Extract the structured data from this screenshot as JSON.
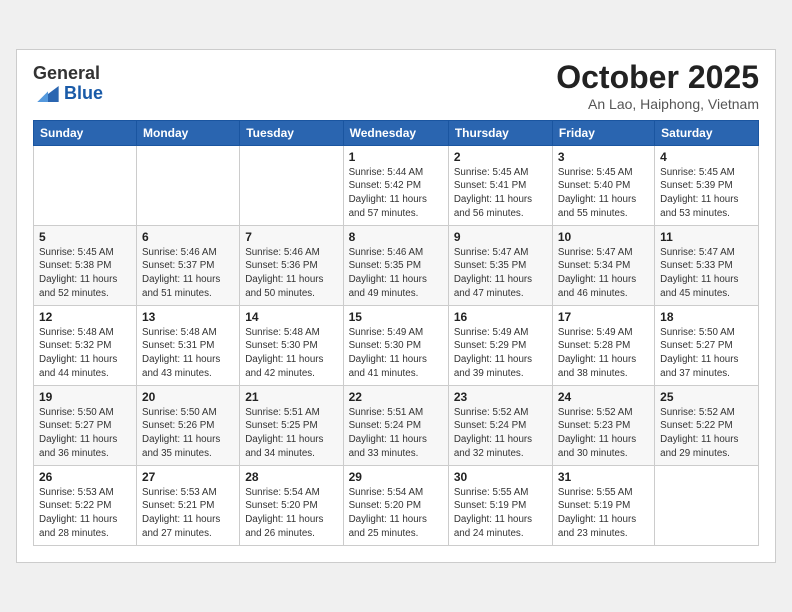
{
  "header": {
    "logo_line1": "General",
    "logo_line2": "Blue",
    "month_title": "October 2025",
    "location": "An Lao, Haiphong, Vietnam"
  },
  "weekdays": [
    "Sunday",
    "Monday",
    "Tuesday",
    "Wednesday",
    "Thursday",
    "Friday",
    "Saturday"
  ],
  "weeks": [
    [
      {
        "day": "",
        "sunrise": "",
        "sunset": "",
        "daylight": ""
      },
      {
        "day": "",
        "sunrise": "",
        "sunset": "",
        "daylight": ""
      },
      {
        "day": "",
        "sunrise": "",
        "sunset": "",
        "daylight": ""
      },
      {
        "day": "1",
        "sunrise": "Sunrise: 5:44 AM",
        "sunset": "Sunset: 5:42 PM",
        "daylight": "Daylight: 11 hours and 57 minutes."
      },
      {
        "day": "2",
        "sunrise": "Sunrise: 5:45 AM",
        "sunset": "Sunset: 5:41 PM",
        "daylight": "Daylight: 11 hours and 56 minutes."
      },
      {
        "day": "3",
        "sunrise": "Sunrise: 5:45 AM",
        "sunset": "Sunset: 5:40 PM",
        "daylight": "Daylight: 11 hours and 55 minutes."
      },
      {
        "day": "4",
        "sunrise": "Sunrise: 5:45 AM",
        "sunset": "Sunset: 5:39 PM",
        "daylight": "Daylight: 11 hours and 53 minutes."
      }
    ],
    [
      {
        "day": "5",
        "sunrise": "Sunrise: 5:45 AM",
        "sunset": "Sunset: 5:38 PM",
        "daylight": "Daylight: 11 hours and 52 minutes."
      },
      {
        "day": "6",
        "sunrise": "Sunrise: 5:46 AM",
        "sunset": "Sunset: 5:37 PM",
        "daylight": "Daylight: 11 hours and 51 minutes."
      },
      {
        "day": "7",
        "sunrise": "Sunrise: 5:46 AM",
        "sunset": "Sunset: 5:36 PM",
        "daylight": "Daylight: 11 hours and 50 minutes."
      },
      {
        "day": "8",
        "sunrise": "Sunrise: 5:46 AM",
        "sunset": "Sunset: 5:35 PM",
        "daylight": "Daylight: 11 hours and 49 minutes."
      },
      {
        "day": "9",
        "sunrise": "Sunrise: 5:47 AM",
        "sunset": "Sunset: 5:35 PM",
        "daylight": "Daylight: 11 hours and 47 minutes."
      },
      {
        "day": "10",
        "sunrise": "Sunrise: 5:47 AM",
        "sunset": "Sunset: 5:34 PM",
        "daylight": "Daylight: 11 hours and 46 minutes."
      },
      {
        "day": "11",
        "sunrise": "Sunrise: 5:47 AM",
        "sunset": "Sunset: 5:33 PM",
        "daylight": "Daylight: 11 hours and 45 minutes."
      }
    ],
    [
      {
        "day": "12",
        "sunrise": "Sunrise: 5:48 AM",
        "sunset": "Sunset: 5:32 PM",
        "daylight": "Daylight: 11 hours and 44 minutes."
      },
      {
        "day": "13",
        "sunrise": "Sunrise: 5:48 AM",
        "sunset": "Sunset: 5:31 PM",
        "daylight": "Daylight: 11 hours and 43 minutes."
      },
      {
        "day": "14",
        "sunrise": "Sunrise: 5:48 AM",
        "sunset": "Sunset: 5:30 PM",
        "daylight": "Daylight: 11 hours and 42 minutes."
      },
      {
        "day": "15",
        "sunrise": "Sunrise: 5:49 AM",
        "sunset": "Sunset: 5:30 PM",
        "daylight": "Daylight: 11 hours and 41 minutes."
      },
      {
        "day": "16",
        "sunrise": "Sunrise: 5:49 AM",
        "sunset": "Sunset: 5:29 PM",
        "daylight": "Daylight: 11 hours and 39 minutes."
      },
      {
        "day": "17",
        "sunrise": "Sunrise: 5:49 AM",
        "sunset": "Sunset: 5:28 PM",
        "daylight": "Daylight: 11 hours and 38 minutes."
      },
      {
        "day": "18",
        "sunrise": "Sunrise: 5:50 AM",
        "sunset": "Sunset: 5:27 PM",
        "daylight": "Daylight: 11 hours and 37 minutes."
      }
    ],
    [
      {
        "day": "19",
        "sunrise": "Sunrise: 5:50 AM",
        "sunset": "Sunset: 5:27 PM",
        "daylight": "Daylight: 11 hours and 36 minutes."
      },
      {
        "day": "20",
        "sunrise": "Sunrise: 5:50 AM",
        "sunset": "Sunset: 5:26 PM",
        "daylight": "Daylight: 11 hours and 35 minutes."
      },
      {
        "day": "21",
        "sunrise": "Sunrise: 5:51 AM",
        "sunset": "Sunset: 5:25 PM",
        "daylight": "Daylight: 11 hours and 34 minutes."
      },
      {
        "day": "22",
        "sunrise": "Sunrise: 5:51 AM",
        "sunset": "Sunset: 5:24 PM",
        "daylight": "Daylight: 11 hours and 33 minutes."
      },
      {
        "day": "23",
        "sunrise": "Sunrise: 5:52 AM",
        "sunset": "Sunset: 5:24 PM",
        "daylight": "Daylight: 11 hours and 32 minutes."
      },
      {
        "day": "24",
        "sunrise": "Sunrise: 5:52 AM",
        "sunset": "Sunset: 5:23 PM",
        "daylight": "Daylight: 11 hours and 30 minutes."
      },
      {
        "day": "25",
        "sunrise": "Sunrise: 5:52 AM",
        "sunset": "Sunset: 5:22 PM",
        "daylight": "Daylight: 11 hours and 29 minutes."
      }
    ],
    [
      {
        "day": "26",
        "sunrise": "Sunrise: 5:53 AM",
        "sunset": "Sunset: 5:22 PM",
        "daylight": "Daylight: 11 hours and 28 minutes."
      },
      {
        "day": "27",
        "sunrise": "Sunrise: 5:53 AM",
        "sunset": "Sunset: 5:21 PM",
        "daylight": "Daylight: 11 hours and 27 minutes."
      },
      {
        "day": "28",
        "sunrise": "Sunrise: 5:54 AM",
        "sunset": "Sunset: 5:20 PM",
        "daylight": "Daylight: 11 hours and 26 minutes."
      },
      {
        "day": "29",
        "sunrise": "Sunrise: 5:54 AM",
        "sunset": "Sunset: 5:20 PM",
        "daylight": "Daylight: 11 hours and 25 minutes."
      },
      {
        "day": "30",
        "sunrise": "Sunrise: 5:55 AM",
        "sunset": "Sunset: 5:19 PM",
        "daylight": "Daylight: 11 hours and 24 minutes."
      },
      {
        "day": "31",
        "sunrise": "Sunrise: 5:55 AM",
        "sunset": "Sunset: 5:19 PM",
        "daylight": "Daylight: 11 hours and 23 minutes."
      },
      {
        "day": "",
        "sunrise": "",
        "sunset": "",
        "daylight": ""
      }
    ]
  ]
}
